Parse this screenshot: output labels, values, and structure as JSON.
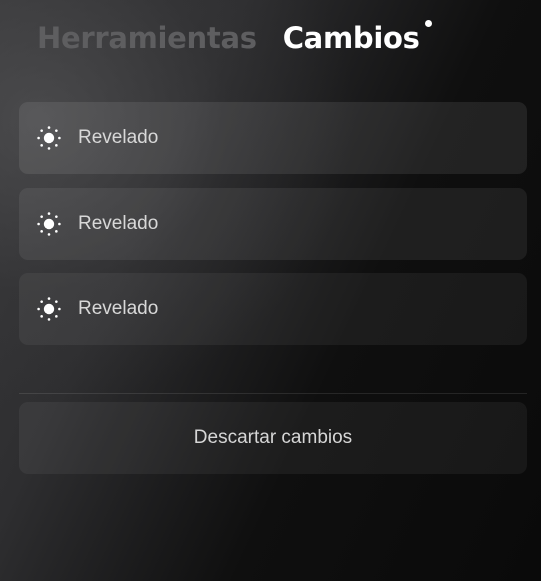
{
  "tabs": {
    "tools": "Herramientas",
    "changes": "Cambios"
  },
  "changes": {
    "items": [
      {
        "label": "Revelado",
        "icon": "sun-icon"
      },
      {
        "label": "Revelado",
        "icon": "sun-icon"
      },
      {
        "label": "Revelado",
        "icon": "sun-icon"
      }
    ],
    "discard_label": "Descartar cambios"
  },
  "colors": {
    "tab_active": "#ffffff",
    "tab_inactive": "#5e5e60",
    "row_background": "#3a3a3c"
  }
}
